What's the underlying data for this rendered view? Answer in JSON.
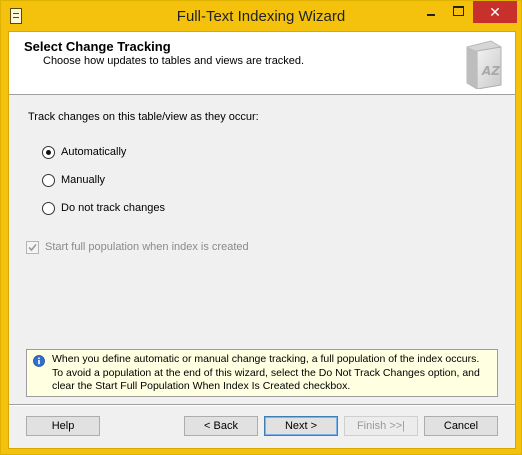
{
  "window": {
    "title": "Full-Text Indexing Wizard",
    "close_glyph": "✕"
  },
  "header": {
    "title": "Select Change Tracking",
    "subtitle": "Choose how updates to tables and views are tracked.",
    "icon": "book-az-icon"
  },
  "main": {
    "prompt": "Track changes on this table/view as they occur:",
    "options": [
      {
        "label": "Automatically",
        "selected": true
      },
      {
        "label": "Manually",
        "selected": false
      },
      {
        "label": "Do not track changes",
        "selected": false
      }
    ],
    "start_population": {
      "label": "Start full population when index is created",
      "checked": true,
      "enabled": false
    }
  },
  "info": {
    "icon": "info-icon",
    "text": "When you define automatic or manual change tracking, a full population of the index occurs. To avoid a population at the end of this wizard, select the Do Not Track Changes option, and clear the Start Full Population When Index Is Created checkbox."
  },
  "buttons": {
    "help": "Help",
    "back": "< Back",
    "next": "Next >",
    "finish": "Finish >>|",
    "cancel": "Cancel"
  },
  "colors": {
    "titlebar": "#f4c20d",
    "close": "#c7302b",
    "info_background": "#ffffe1"
  }
}
